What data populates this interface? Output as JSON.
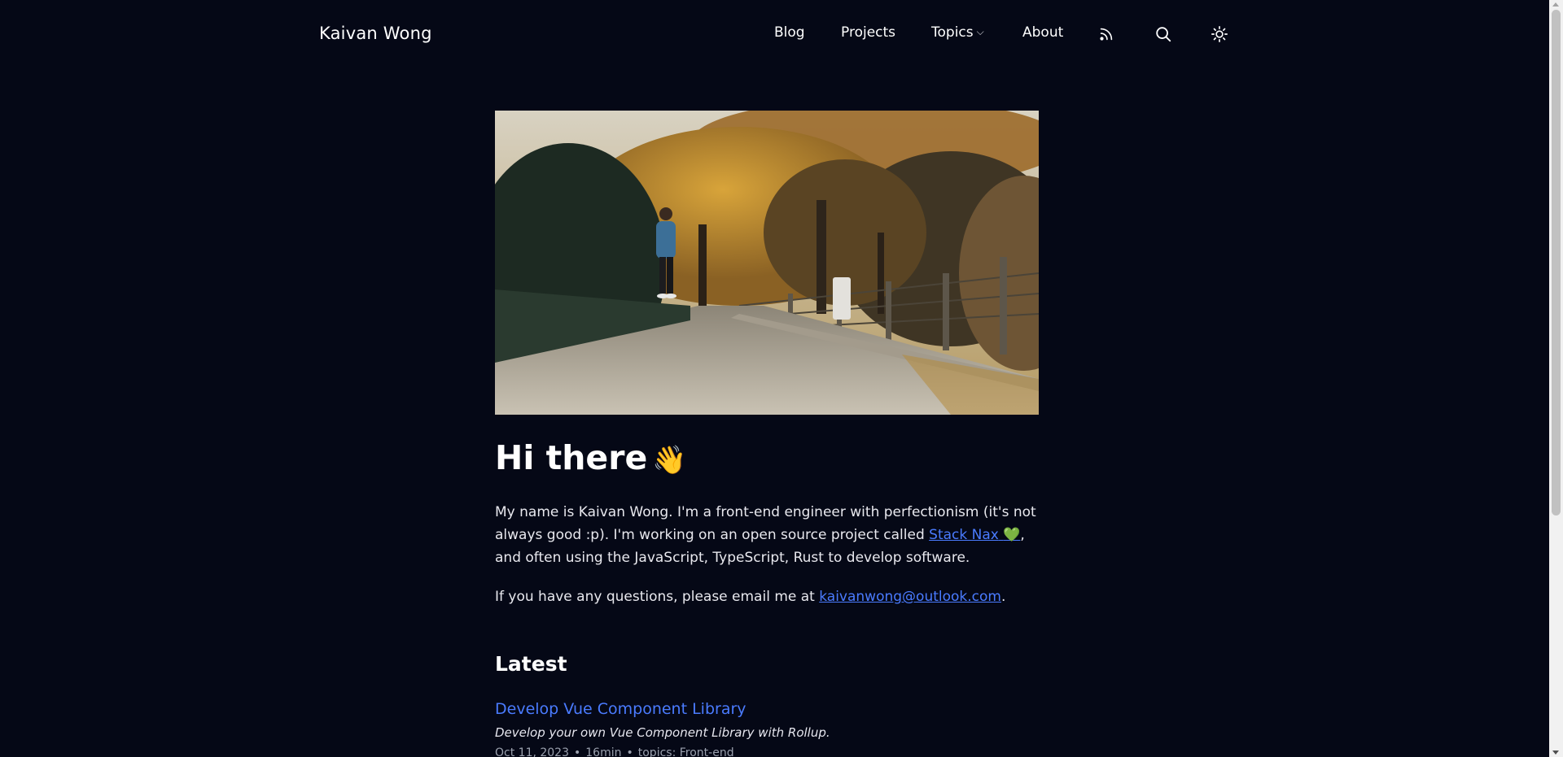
{
  "header": {
    "brand": "Kaivan Wong",
    "nav": [
      {
        "label": "Blog"
      },
      {
        "label": "Projects"
      },
      {
        "label": "Topics",
        "has_dropdown": true
      },
      {
        "label": "About"
      }
    ],
    "icons": [
      "rss-icon",
      "search-icon",
      "sun-icon"
    ]
  },
  "hero": {
    "image": "person-standing-on-autumn-road"
  },
  "intro": {
    "heading": "Hi there",
    "wave": "👋",
    "para1_before": "My name is Kaivan Wong. I'm a front-end engineer with perfectionism (it's not always good :p). I'm working on an open source project called ",
    "project_link": "Stack Nax",
    "heart": "💚",
    "para1_after": ", and often using the JavaScript, TypeScript, Rust to develop software.",
    "para2_before": "If you have any questions, please email me at ",
    "email": "kaivanwong@outlook.com",
    "para2_after": "."
  },
  "latest": {
    "title": "Latest",
    "posts": [
      {
        "title": "Develop Vue Component Library",
        "description": "Develop your own Vue Component Library with Rollup.",
        "date": "Oct 11, 2023",
        "read_time": "16min",
        "topics": "topics: Front-end"
      }
    ]
  },
  "colors": {
    "background": "#050816",
    "link": "#4a7bff",
    "text": "#e6e6ea"
  }
}
